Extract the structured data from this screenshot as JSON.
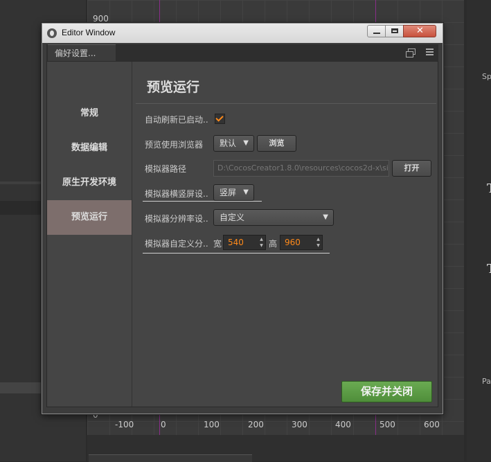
{
  "background": {
    "scene_labels": {
      "y_top": "900",
      "y_zero": "0",
      "x_ticks": [
        "-100",
        "0",
        "100",
        "200",
        "300",
        "400",
        "500",
        "600"
      ]
    },
    "right_panel": {
      "label_sp": "Sp",
      "label_pa": "Pa"
    },
    "bottom_tabs": [
      "…",
      "…"
    ]
  },
  "window": {
    "title": "Editor Window",
    "tab_label": "偏好设置...",
    "sidebar": {
      "items": [
        {
          "label": "常规"
        },
        {
          "label": "数据编辑"
        },
        {
          "label": "原生开发环境"
        },
        {
          "label": "预览运行"
        }
      ],
      "active_index": 3
    },
    "section_title": "预览运行",
    "rows": {
      "auto_refresh": {
        "label": "自动刷新已启动..",
        "checked": true
      },
      "browser": {
        "label": "预览使用浏览器",
        "select_value": "默认",
        "browse_label": "浏览"
      },
      "simulator_path": {
        "label": "模拟器路径",
        "value": "D:\\CocosCreator1.8.0\\resources\\cocos2d-x\\si",
        "open_label": "打开"
      },
      "orientation": {
        "label": "模拟器横竖屏设..",
        "select_value": "竖屏"
      },
      "resolution": {
        "label": "模拟器分辨率设..",
        "select_value": "自定义"
      },
      "custom_size": {
        "label": "模拟器自定义分..",
        "width_label": "宽",
        "width_value": "540",
        "height_label": "高",
        "height_value": "960"
      }
    },
    "save_label": "保存并关闭"
  },
  "colors": {
    "accent_orange": "#ff8a1a",
    "save_green": "#5a9c44",
    "active_sidebar": "#7d6e6c"
  }
}
